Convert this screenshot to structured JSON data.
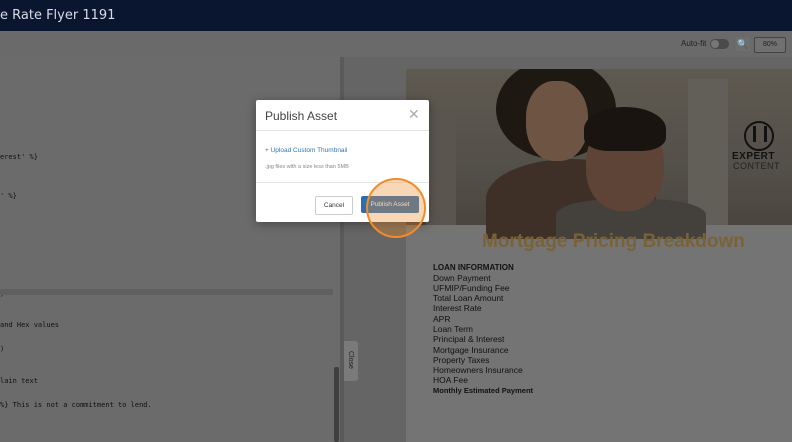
{
  "app": {
    "title": "e Rate Flyer 1191"
  },
  "toolbar": {
    "autofit_label": "Auto-fit",
    "zoom_icon": "zoom-in-icon",
    "zoom_value": "80%"
  },
  "editor": {
    "lines": [
      "erest' %}",
      "' %}",
      ")",
      "and Hex values",
      ")",
      "lain text",
      "%} This is not a commitment to lend."
    ]
  },
  "preview": {
    "close_label": "Close"
  },
  "flyer": {
    "brand_line1": "EXPERT",
    "brand_line2": "CONTENT",
    "title": "Mortgage Pricing Breakdown",
    "section_heading": "LOAN INFORMATION",
    "items": [
      "Down Payment",
      "UFMIP/Funding Fee",
      "Total Loan Amount",
      "Interest Rate",
      "APR",
      "Loan Term",
      "Principal & Interest",
      "Mortgage Insurance",
      "Property Taxes",
      "Homeowners Insurance",
      "HOA Fee"
    ],
    "total_label": "Monthly Estimated Payment"
  },
  "modal": {
    "title": "Publish Asset",
    "close_icon": "close-icon",
    "upload_label": "+ Upload Custom Thumbnail",
    "hint": ".jpg files with a size less than 5MB",
    "cancel_label": "Cancel",
    "publish_label": "Publish Asset"
  },
  "colors": {
    "topbar": "#0a1530",
    "link": "#2a78b8",
    "primary_button": "#2c6fb0",
    "highlight": "#f08c2a",
    "flyer_title": "#7a6238"
  }
}
